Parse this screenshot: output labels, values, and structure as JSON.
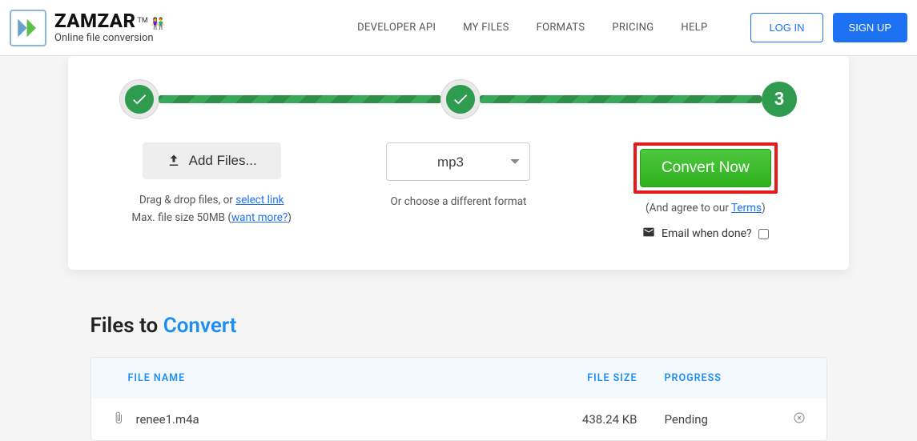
{
  "brand": {
    "name": "ZAMZAR",
    "tagline": "Online file conversion"
  },
  "nav": {
    "developer": "DEVELOPER API",
    "myfiles": "MY FILES",
    "formats": "FORMATS",
    "pricing": "PRICING",
    "help": "HELP",
    "login": "LOG IN",
    "signup": "SIGN UP"
  },
  "steps": {
    "step3": "3"
  },
  "step1": {
    "button": "Add Files...",
    "drag": "Drag & drop files, or ",
    "select_link": "select link",
    "max_prefix": "Max. file size 50MB (",
    "want_more": "want more?",
    "max_suffix": ")"
  },
  "step2": {
    "selected_format": "mp3",
    "caption": "Or choose a different format"
  },
  "step3": {
    "button": "Convert Now",
    "agree_prefix": "(And agree to our ",
    "terms": "Terms",
    "agree_suffix": ")",
    "email_label": "Email when done?"
  },
  "files": {
    "title_a": "Files to ",
    "title_b": "Convert",
    "head_name": "FILE NAME",
    "head_size": "FILE SIZE",
    "head_prog": "PROGRESS",
    "rows": [
      {
        "name": "renee1.m4a",
        "size": "438.24 KB",
        "progress": "Pending"
      }
    ]
  }
}
